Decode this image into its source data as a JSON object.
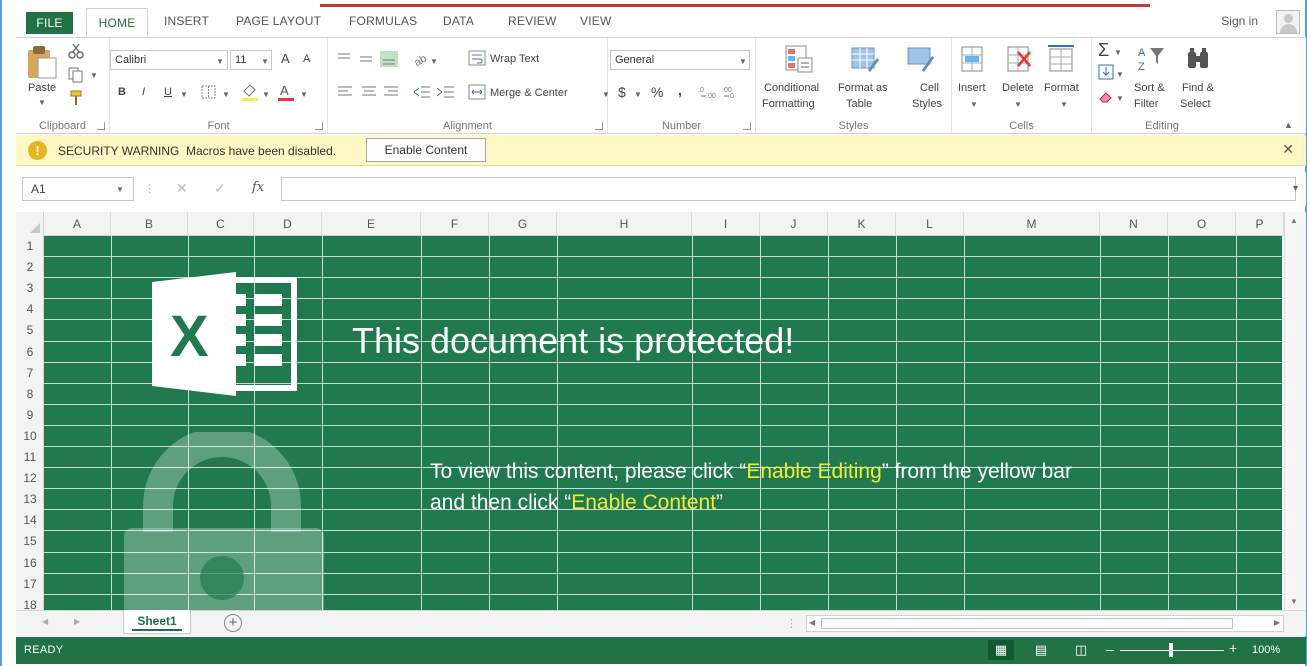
{
  "menubar": {
    "tabs": [
      "FILE",
      "HOME",
      "INSERT",
      "PAGE LAYOUT",
      "FORMULAS",
      "DATA",
      "REVIEW",
      "VIEW"
    ],
    "sign_in": "Sign in"
  },
  "ribbon": {
    "clipboard": {
      "label": "Clipboard",
      "paste": "Paste"
    },
    "font": {
      "label": "Font",
      "family": "Calibri",
      "size": "11",
      "bold": "B",
      "italic": "I",
      "underline": "U",
      "grow": "A",
      "shrink": "A"
    },
    "alignment": {
      "label": "Alignment",
      "wrap_text": "Wrap Text",
      "merge_center": "Merge & Center"
    },
    "number": {
      "label": "Number",
      "format": "General",
      "currency": "$",
      "percent": "%",
      "comma": ","
    },
    "styles": {
      "label": "Styles",
      "conditional_1": "Conditional",
      "conditional_2": "Formatting",
      "format_table_1": "Format as",
      "format_table_2": "Table",
      "cell_styles_1": "Cell",
      "cell_styles_2": "Styles"
    },
    "cells": {
      "label": "Cells",
      "insert": "Insert",
      "delete": "Delete",
      "format": "Format"
    },
    "editing": {
      "label": "Editing",
      "sort_1": "Sort &",
      "sort_2": "Filter",
      "find_1": "Find &",
      "find_2": "Select"
    }
  },
  "security_bar": {
    "title": "SECURITY WARNING",
    "message": "Macros have been disabled.",
    "button": "Enable Content"
  },
  "formula_bar": {
    "name_box": "A1",
    "fx": "fx",
    "value": ""
  },
  "columns": [
    "A",
    "B",
    "C",
    "D",
    "E",
    "F",
    "G",
    "H",
    "I",
    "J",
    "K",
    "L",
    "M",
    "N",
    "O",
    "P"
  ],
  "rows": [
    "1",
    "2",
    "3",
    "4",
    "5",
    "6",
    "7",
    "8",
    "9",
    "10",
    "11",
    "12",
    "13",
    "14",
    "15",
    "16",
    "17",
    "18"
  ],
  "overlay": {
    "headline": "This document is protected!",
    "line1_a": "To view this content, please click “",
    "line1_highlight": "Enable Editing",
    "line1_b": "” from the yellow bar",
    "line2_a": "and then click “",
    "line2_highlight": "Enable Content",
    "line2_b": "”",
    "logo_letter": "X",
    "highlight_color": "#f2ea3b",
    "background_color": "#217a4f"
  },
  "sheet_tabs": {
    "active": "Sheet1",
    "add": "+"
  },
  "status_bar": {
    "state": "READY",
    "zoom": "100%"
  },
  "colors": {
    "excel_green": "#217346",
    "warning_bar": "#fff8c5"
  }
}
